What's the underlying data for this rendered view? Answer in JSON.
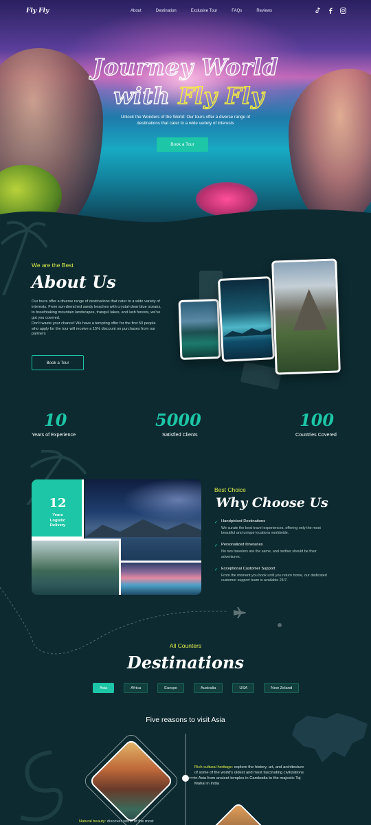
{
  "nav": {
    "logo": "Fly Fly",
    "links": [
      "About",
      "Destination",
      "Exclusive Tour",
      "FAQs",
      "Reviews"
    ],
    "socials": [
      "tiktok-icon",
      "facebook-icon",
      "instagram-icon"
    ]
  },
  "hero": {
    "title_line1": "Journey World",
    "title_line2_prefix": "with ",
    "title_line2_accent": "Fly Fly",
    "subtitle": "Unlock the Wonders of the World: Our tours offer a diverse range of destinations that cater to a wide variety of interests",
    "cta": "Book a Tour"
  },
  "about": {
    "eyebrow": "We are the Best",
    "title": "About Us",
    "text": "Our tours offer a diverse range of destinations that cater to a wide variety of interests. From sun-drenched sandy beaches with crystal-clear blue oceans, to breathtaking mountain landscapes, tranquil lakes, and lush forests, we've got you covered.",
    "text2": "Don't waste your chance! We have a tempting offer for the first 50 people who apply for the tour will receive a 15% discount on purchases from our partners",
    "cta": "Book a Tour"
  },
  "stats": [
    {
      "value": "10",
      "label": "Years of Experience"
    },
    {
      "value": "5000",
      "label": "Satisfied Clients"
    },
    {
      "value": "100",
      "label": "Countries Covered"
    }
  ],
  "why": {
    "eyebrow": "Best Choice",
    "title": "Why Choose Us",
    "badge_num": "12",
    "badge_label_1": "Years",
    "badge_label_2": "Logistic",
    "badge_label_3": "Delivery",
    "items": [
      {
        "title": "Handpicked Destinations",
        "desc": "We curate the best travel experiences, offering only the most beautiful and unique locations worldwide."
      },
      {
        "title": "Personalized Itineraries",
        "desc": "No two travelers are the same, and neither should be their adventures."
      },
      {
        "title": "Exceptional Customer Support",
        "desc": "From the moment you book until you return home, our dedicated customer support team is available 24/7."
      }
    ]
  },
  "destinations": {
    "eyebrow": "All Counters",
    "title": "Destinations",
    "tabs": [
      "Asia",
      "Africa",
      "Europe",
      "Australia",
      "USA",
      "New Zeland"
    ],
    "active_tab": "Asia",
    "subtitle": "Five reasons to visit Asia",
    "reason1_hl": "Rich cultural heritage:",
    "reason1_text": " explore the history, art, and architecture of some of the world's oldest and most fascinating civilizations in Asia from ancient temples in Cambodia to the majestic Taj Mahal in India",
    "reason2_hl": "Natural beauty:",
    "reason2_text": " discover some of the most"
  },
  "colors": {
    "accent": "#1cc6a6",
    "highlight": "#e3ef4a",
    "background": "#0c2a30"
  }
}
